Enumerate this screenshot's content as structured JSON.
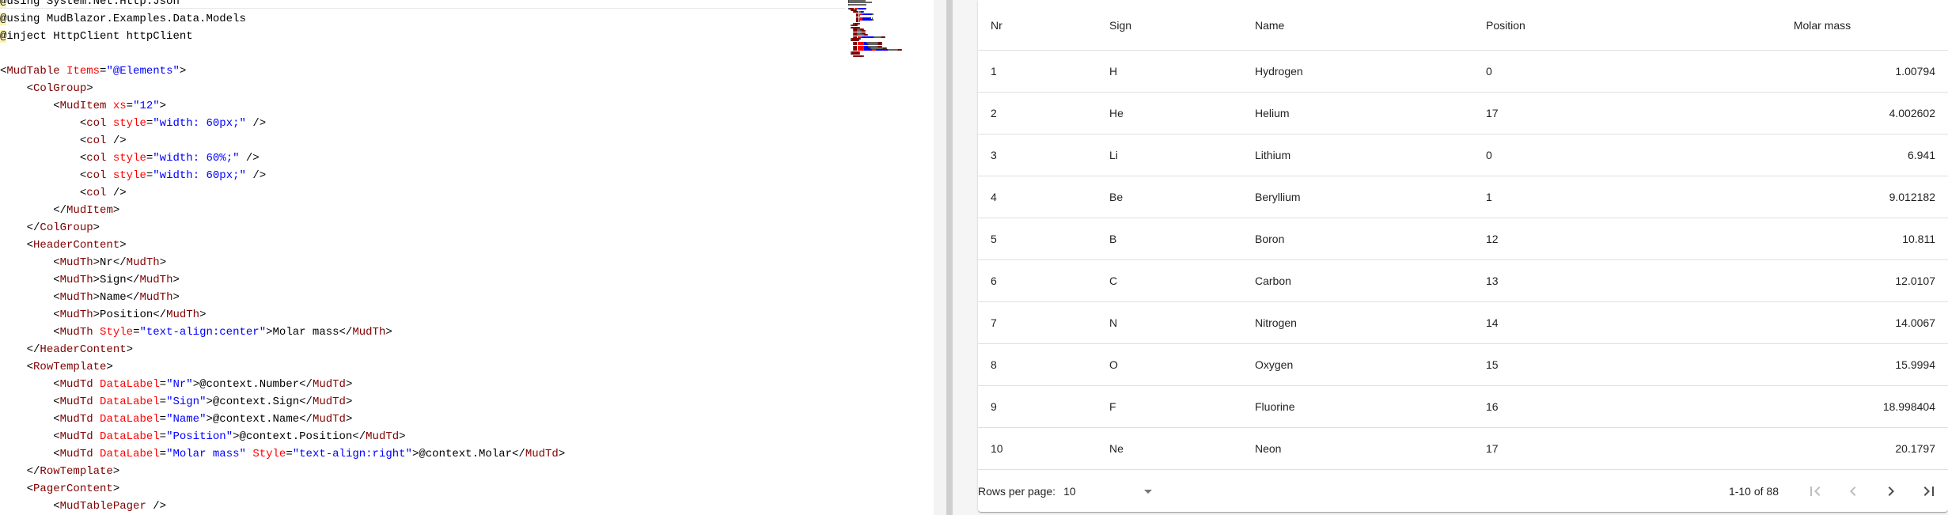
{
  "editor": {
    "lines": [
      [
        [
          "at",
          "@"
        ],
        [
          "plain",
          "using System.Net.Http.Json"
        ]
      ],
      [
        [
          "at",
          "@"
        ],
        [
          "plain",
          "using MudBlazor.Examples.Data.Models"
        ]
      ],
      [
        [
          "at",
          "@"
        ],
        [
          "plain",
          "inject HttpClient httpClient"
        ]
      ],
      [],
      [
        [
          "punc",
          "<"
        ],
        [
          "tag",
          "MudTable"
        ],
        [
          "plain",
          " "
        ],
        [
          "attr",
          "Items"
        ],
        [
          "punc",
          "="
        ],
        [
          "str",
          "\"@Elements\""
        ],
        [
          "punc",
          ">"
        ]
      ],
      [
        [
          "plain",
          "    "
        ],
        [
          "punc",
          "<"
        ],
        [
          "tag",
          "ColGroup"
        ],
        [
          "punc",
          ">"
        ]
      ],
      [
        [
          "plain",
          "        "
        ],
        [
          "punc",
          "<"
        ],
        [
          "tag",
          "MudItem"
        ],
        [
          "plain",
          " "
        ],
        [
          "attr",
          "xs"
        ],
        [
          "punc",
          "="
        ],
        [
          "str",
          "\"12\""
        ],
        [
          "punc",
          ">"
        ]
      ],
      [
        [
          "plain",
          "            "
        ],
        [
          "punc",
          "<"
        ],
        [
          "tag",
          "col"
        ],
        [
          "plain",
          " "
        ],
        [
          "attr",
          "style"
        ],
        [
          "punc",
          "="
        ],
        [
          "str",
          "\"width: 60px;\""
        ],
        [
          "plain",
          " "
        ],
        [
          "punc",
          "/>"
        ]
      ],
      [
        [
          "plain",
          "            "
        ],
        [
          "punc",
          "<"
        ],
        [
          "tag",
          "col"
        ],
        [
          "plain",
          " "
        ],
        [
          "punc",
          "/>"
        ]
      ],
      [
        [
          "plain",
          "            "
        ],
        [
          "punc",
          "<"
        ],
        [
          "tag",
          "col"
        ],
        [
          "plain",
          " "
        ],
        [
          "attr",
          "style"
        ],
        [
          "punc",
          "="
        ],
        [
          "str",
          "\"width: 60%;\""
        ],
        [
          "plain",
          " "
        ],
        [
          "punc",
          "/>"
        ]
      ],
      [
        [
          "plain",
          "            "
        ],
        [
          "punc",
          "<"
        ],
        [
          "tag",
          "col"
        ],
        [
          "plain",
          " "
        ],
        [
          "attr",
          "style"
        ],
        [
          "punc",
          "="
        ],
        [
          "str",
          "\"width: 60px;\""
        ],
        [
          "plain",
          " "
        ],
        [
          "punc",
          "/>"
        ]
      ],
      [
        [
          "plain",
          "            "
        ],
        [
          "punc",
          "<"
        ],
        [
          "tag",
          "col"
        ],
        [
          "plain",
          " "
        ],
        [
          "punc",
          "/>"
        ]
      ],
      [
        [
          "plain",
          "        "
        ],
        [
          "punc",
          "</"
        ],
        [
          "tag",
          "MudItem"
        ],
        [
          "punc",
          ">"
        ]
      ],
      [
        [
          "plain",
          "    "
        ],
        [
          "punc",
          "</"
        ],
        [
          "tag",
          "ColGroup"
        ],
        [
          "punc",
          ">"
        ]
      ],
      [
        [
          "plain",
          "    "
        ],
        [
          "punc",
          "<"
        ],
        [
          "tag",
          "HeaderContent"
        ],
        [
          "punc",
          ">"
        ]
      ],
      [
        [
          "plain",
          "        "
        ],
        [
          "punc",
          "<"
        ],
        [
          "tag",
          "MudTh"
        ],
        [
          "punc",
          ">"
        ],
        [
          "plain",
          "Nr"
        ],
        [
          "punc",
          "</"
        ],
        [
          "tag",
          "MudTh"
        ],
        [
          "punc",
          ">"
        ]
      ],
      [
        [
          "plain",
          "        "
        ],
        [
          "punc",
          "<"
        ],
        [
          "tag",
          "MudTh"
        ],
        [
          "punc",
          ">"
        ],
        [
          "plain",
          "Sign"
        ],
        [
          "punc",
          "</"
        ],
        [
          "tag",
          "MudTh"
        ],
        [
          "punc",
          ">"
        ]
      ],
      [
        [
          "plain",
          "        "
        ],
        [
          "punc",
          "<"
        ],
        [
          "tag",
          "MudTh"
        ],
        [
          "punc",
          ">"
        ],
        [
          "plain",
          "Name"
        ],
        [
          "punc",
          "</"
        ],
        [
          "tag",
          "MudTh"
        ],
        [
          "punc",
          ">"
        ]
      ],
      [
        [
          "plain",
          "        "
        ],
        [
          "punc",
          "<"
        ],
        [
          "tag",
          "MudTh"
        ],
        [
          "punc",
          ">"
        ],
        [
          "plain",
          "Position"
        ],
        [
          "punc",
          "</"
        ],
        [
          "tag",
          "MudTh"
        ],
        [
          "punc",
          ">"
        ]
      ],
      [
        [
          "plain",
          "        "
        ],
        [
          "punc",
          "<"
        ],
        [
          "tag",
          "MudTh"
        ],
        [
          "plain",
          " "
        ],
        [
          "attr",
          "Style"
        ],
        [
          "punc",
          "="
        ],
        [
          "str",
          "\"text-align:center\""
        ],
        [
          "punc",
          ">"
        ],
        [
          "plain",
          "Molar mass"
        ],
        [
          "punc",
          "</"
        ],
        [
          "tag",
          "MudTh"
        ],
        [
          "punc",
          ">"
        ]
      ],
      [
        [
          "plain",
          "    "
        ],
        [
          "punc",
          "</"
        ],
        [
          "tag",
          "HeaderContent"
        ],
        [
          "punc",
          ">"
        ]
      ],
      [
        [
          "plain",
          "    "
        ],
        [
          "punc",
          "<"
        ],
        [
          "tag",
          "RowTemplate"
        ],
        [
          "punc",
          ">"
        ]
      ],
      [
        [
          "plain",
          "        "
        ],
        [
          "punc",
          "<"
        ],
        [
          "tag",
          "MudTd"
        ],
        [
          "plain",
          " "
        ],
        [
          "attr",
          "DataLabel"
        ],
        [
          "punc",
          "="
        ],
        [
          "str",
          "\"Nr\""
        ],
        [
          "punc",
          ">"
        ],
        [
          "plain",
          "@context.Number"
        ],
        [
          "punc",
          "</"
        ],
        [
          "tag",
          "MudTd"
        ],
        [
          "punc",
          ">"
        ]
      ],
      [
        [
          "plain",
          "        "
        ],
        [
          "punc",
          "<"
        ],
        [
          "tag",
          "MudTd"
        ],
        [
          "plain",
          " "
        ],
        [
          "attr",
          "DataLabel"
        ],
        [
          "punc",
          "="
        ],
        [
          "str",
          "\"Sign\""
        ],
        [
          "punc",
          ">"
        ],
        [
          "plain",
          "@context.Sign"
        ],
        [
          "punc",
          "</"
        ],
        [
          "tag",
          "MudTd"
        ],
        [
          "punc",
          ">"
        ]
      ],
      [
        [
          "plain",
          "        "
        ],
        [
          "punc",
          "<"
        ],
        [
          "tag",
          "MudTd"
        ],
        [
          "plain",
          " "
        ],
        [
          "attr",
          "DataLabel"
        ],
        [
          "punc",
          "="
        ],
        [
          "str",
          "\"Name\""
        ],
        [
          "punc",
          ">"
        ],
        [
          "plain",
          "@context.Name"
        ],
        [
          "punc",
          "</"
        ],
        [
          "tag",
          "MudTd"
        ],
        [
          "punc",
          ">"
        ]
      ],
      [
        [
          "plain",
          "        "
        ],
        [
          "punc",
          "<"
        ],
        [
          "tag",
          "MudTd"
        ],
        [
          "plain",
          " "
        ],
        [
          "attr",
          "DataLabel"
        ],
        [
          "punc",
          "="
        ],
        [
          "str",
          "\"Position\""
        ],
        [
          "punc",
          ">"
        ],
        [
          "plain",
          "@context.Position"
        ],
        [
          "punc",
          "</"
        ],
        [
          "tag",
          "MudTd"
        ],
        [
          "punc",
          ">"
        ]
      ],
      [
        [
          "plain",
          "        "
        ],
        [
          "punc",
          "<"
        ],
        [
          "tag",
          "MudTd"
        ],
        [
          "plain",
          " "
        ],
        [
          "attr",
          "DataLabel"
        ],
        [
          "punc",
          "="
        ],
        [
          "str",
          "\"Molar mass\""
        ],
        [
          "plain",
          " "
        ],
        [
          "attr",
          "Style"
        ],
        [
          "punc",
          "="
        ],
        [
          "str",
          "\"text-align:right\""
        ],
        [
          "punc",
          ">"
        ],
        [
          "plain",
          "@context.Molar"
        ],
        [
          "punc",
          "</"
        ],
        [
          "tag",
          "MudTd"
        ],
        [
          "punc",
          ">"
        ]
      ],
      [
        [
          "plain",
          "    "
        ],
        [
          "punc",
          "</"
        ],
        [
          "tag",
          "RowTemplate"
        ],
        [
          "punc",
          ">"
        ]
      ],
      [
        [
          "plain",
          "    "
        ],
        [
          "punc",
          "<"
        ],
        [
          "tag",
          "PagerContent"
        ],
        [
          "punc",
          ">"
        ]
      ],
      [
        [
          "plain",
          "        "
        ],
        [
          "punc",
          "<"
        ],
        [
          "tag",
          "MudTablePager"
        ],
        [
          "plain",
          " "
        ],
        [
          "punc",
          "/>"
        ]
      ]
    ]
  },
  "colors": {
    "tag": "#800000",
    "attr": "#ff0000",
    "string": "#0000ff",
    "directive_bg": "#fbf3b4"
  },
  "table": {
    "headers": [
      "Nr",
      "Sign",
      "Name",
      "Position",
      "Molar mass"
    ],
    "rows": [
      [
        "1",
        "H",
        "Hydrogen",
        "0",
        "1.00794"
      ],
      [
        "2",
        "He",
        "Helium",
        "17",
        "4.002602"
      ],
      [
        "3",
        "Li",
        "Lithium",
        "0",
        "6.941"
      ],
      [
        "4",
        "Be",
        "Beryllium",
        "1",
        "9.012182"
      ],
      [
        "5",
        "B",
        "Boron",
        "12",
        "10.811"
      ],
      [
        "6",
        "C",
        "Carbon",
        "13",
        "12.0107"
      ],
      [
        "7",
        "N",
        "Nitrogen",
        "14",
        "14.0067"
      ],
      [
        "8",
        "O",
        "Oxygen",
        "15",
        "15.9994"
      ],
      [
        "9",
        "F",
        "Fluorine",
        "16",
        "18.998404"
      ],
      [
        "10",
        "Ne",
        "Neon",
        "17",
        "20.1797"
      ]
    ]
  },
  "pager": {
    "rows_per_page_label": "Rows per page:",
    "rows_per_page_value": "10",
    "range_text": "1-10 of 88",
    "icons": {
      "first": "first-page-icon",
      "prev": "chevron-left-icon",
      "next": "chevron-right-icon",
      "last": "last-page-icon"
    }
  }
}
